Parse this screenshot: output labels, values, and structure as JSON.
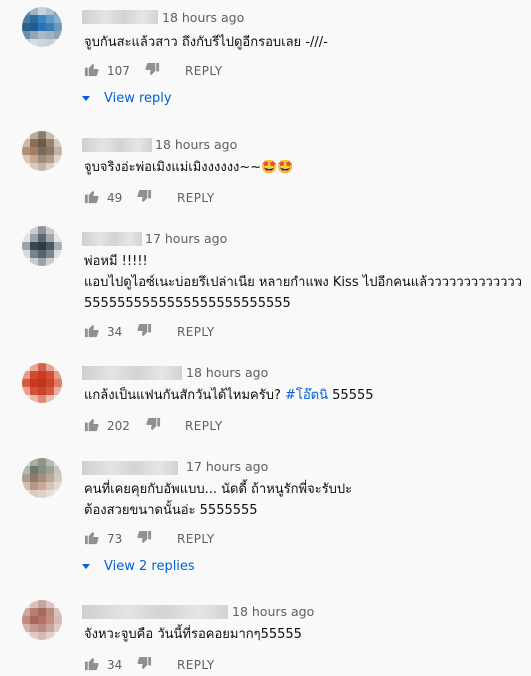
{
  "comments": [
    {
      "time": "18 hours ago",
      "text": "จูบกันสะแล้วสาว ถึงกับรีไปดูอีกรอบเลย -///-",
      "likes": "107",
      "reply": "REPLY",
      "view_replies": "View reply",
      "avatar": [
        "#6a8aa6",
        "#9bb3c6",
        "#c8d3dc",
        "#b0c2cf",
        "#7e9bb3",
        "#4f7a9c",
        "#2e6a9c",
        "#3c86c2",
        "#5f9ccc",
        "#84afd0",
        "#2a5f8e",
        "#1d5c94",
        "#2c74b3",
        "#3a7fba",
        "#6d98bb",
        "#6f8ea8",
        "#8fa7ba",
        "#a9b9c6",
        "#9fb2c2",
        "#8ea4b6",
        "#c6ced5",
        "#d5dbe0",
        "#cdd5dc",
        "#c7d0d8",
        "#d8dde1"
      ]
    },
    {
      "time": "18 hours ago",
      "text": "จูบจริงอ่ะพ่อเมิงแม่เมิงงงงงง~~🤩🤩",
      "likes": "49",
      "reply": "REPLY",
      "avatar": [
        "#e9e4e0",
        "#b9aa9c",
        "#8e7c6e",
        "#c9bcb0",
        "#efe9e4",
        "#cdb9a6",
        "#8d6d55",
        "#6b5a4c",
        "#9a8372",
        "#d8c9bc",
        "#b09078",
        "#a47e63",
        "#7a6b5f",
        "#8a7766",
        "#c7b2a1",
        "#d9c7b8",
        "#c6a892",
        "#9d8c7e",
        "#b29b88",
        "#e1d4ca",
        "#efebe8",
        "#d9ccc2",
        "#c4b6aa",
        "#ddd2c9",
        "#f2eeeb"
      ]
    },
    {
      "time": "17 hours ago",
      "text": "พ่อหมี !!!!!\nแอบไปดูไอซ์เนะบ่อยรึเปล่าเนีย หลายกำแพง Kiss ไปอีกคนแล้ววววววววววววว\n5555555555555555555555555",
      "likes": "34",
      "reply": "REPLY",
      "avatar": [
        "#eeeeee",
        "#c9ccd0",
        "#8c939b",
        "#c6c9cd",
        "#efefef",
        "#e3e4e6",
        "#9aa1a8",
        "#5d6670",
        "#a2a7ad",
        "#e6e7e8",
        "#9aa3ad",
        "#3b4654",
        "#2d3a4a",
        "#4c5764",
        "#a7adb4",
        "#d7d9dc",
        "#79818a",
        "#5a636d",
        "#7c848c",
        "#dcdee0",
        "#f2f2f2",
        "#c8cbce",
        "#9ea3a8",
        "#cbcdd0",
        "#f4f4f4"
      ]
    },
    {
      "time": "18 hours ago",
      "text": "แกล้งเป็นแฟนกันสักวันได้ไหมครับ? ",
      "hashtag": "#โอ๊ตนิ",
      "tail": " 55555",
      "likes": "202",
      "reply": "REPLY",
      "avatar": [
        "#f2e2dc",
        "#e6a898",
        "#d4614a",
        "#e3a392",
        "#f1ddd6",
        "#e49a86",
        "#cf4a2f",
        "#c63d22",
        "#d35237",
        "#e79c88",
        "#d8593f",
        "#c83a1f",
        "#c0361b",
        "#cc4429",
        "#dd7a62",
        "#e8a08d",
        "#d25236",
        "#c8452a",
        "#d35b40",
        "#eab2a3",
        "#f4e6e1",
        "#e9b6a8",
        "#dd8a74",
        "#ecbcaf",
        "#f6ece8"
      ]
    },
    {
      "time": "17 hours ago",
      "text": "คนที่เคยคุยกับอัพแบบ... นัดดี้ ถ้าหนูรักพี่จะรับปะ\nต้องสวยขนาดนั้นอ่ะ 5555555",
      "likes": "73",
      "reply": "REPLY",
      "view_replies": "View 2 replies",
      "avatar": [
        "#d6d8d4",
        "#a9aea5",
        "#8e958a",
        "#b5b9b1",
        "#dcdedb",
        "#b2b6ae",
        "#6f7a6c",
        "#858f82",
        "#9ba296",
        "#c4c7c1",
        "#a99e94",
        "#8a7b6e",
        "#a58f7c",
        "#b9a89a",
        "#cfc8c1",
        "#d3bdb0",
        "#b79886",
        "#c9ab98",
        "#d7c2b4",
        "#e3d8d0",
        "#ebe2dc",
        "#dccabe",
        "#e0d2c8",
        "#e8ddd5",
        "#f1ece8"
      ]
    },
    {
      "time": "18 hours ago",
      "text": "จังหวะจูบคือ วันนี้ที่รอคอยมากๆ55555",
      "likes": "34",
      "reply": "REPLY",
      "avatar": [
        "#f0e8e6",
        "#d9c2bd",
        "#c7a59d",
        "#dcc6c1",
        "#f2ebe9",
        "#cfa8a0",
        "#b67f73",
        "#a46a5d",
        "#bd8c80",
        "#dcc0ba",
        "#c28b7f",
        "#a8685b",
        "#b47264",
        "#c28d82",
        "#d8b8b1",
        "#d6b2aa",
        "#c29a90",
        "#b98a80",
        "#c9a49b",
        "#e2cbc6",
        "#efe4e1",
        "#dfcac5",
        "#d5bbb4",
        "#e3d0cb",
        "#f3ecea"
      ]
    }
  ]
}
